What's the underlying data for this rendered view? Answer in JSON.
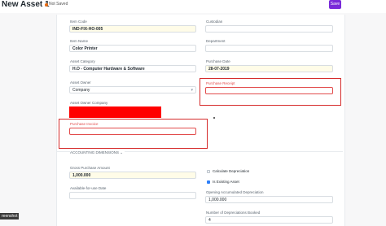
{
  "header": {
    "title": "New Asset 1",
    "status": "Not Saved",
    "save_label": "Save"
  },
  "fields": {
    "item_code": {
      "label": "Item Code",
      "value": "IND-FIX-HO-005"
    },
    "item_name": {
      "label": "Item Name",
      "value": "Color Printer"
    },
    "asset_category": {
      "label": "Asset Category",
      "value": "H.O - Computer Hardware & Software"
    },
    "asset_owner": {
      "label": "Asset Owner",
      "value": "Company"
    },
    "asset_owner_company": {
      "label": "Asset Owner Company",
      "value": ""
    },
    "purchase_invoice": {
      "label": "Purchase Invoice",
      "value": ""
    },
    "custodian": {
      "label": "Custodian",
      "value": ""
    },
    "department": {
      "label": "Department",
      "value": ""
    },
    "purchase_date": {
      "label": "Purchase Date",
      "value": "28-07-2019"
    },
    "purchase_receipt": {
      "label": "Purchase Receipt",
      "value": ""
    }
  },
  "sections": {
    "accounting_dimensions": "ACCOUNTING DIMENSIONS"
  },
  "finance": {
    "gross_purchase_amount": {
      "label": "Gross Purchase Amount",
      "value": "1,000.000"
    },
    "available_for_use_date": {
      "label": "Available-for-use Date",
      "value": ""
    },
    "calculate_depreciation": {
      "label": "Calculate Depreciation",
      "checked": false
    },
    "is_existing_asset": {
      "label": "Is Existing Asset",
      "checked": true
    },
    "opening_accumulated_depreciation": {
      "label": "Opening Accumulated Depreciation",
      "value": "1,000.000"
    },
    "number_of_depreciations_booked": {
      "label": "Number of Depreciations Booked",
      "value": "4"
    }
  },
  "misc": {
    "screenshot_tag": "reenshot"
  },
  "colors": {
    "primary": "#7a2bd9",
    "highlight": "#d52b2b",
    "redaction": "#ff0000",
    "mandatory_bg": "#fffce8"
  }
}
